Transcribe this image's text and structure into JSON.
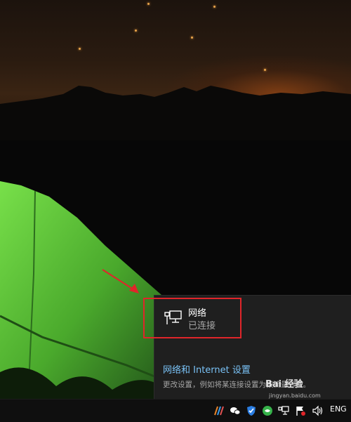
{
  "flyout": {
    "network_name": "网络",
    "network_status": "已连接",
    "settings_link": "网络和 Internet 设置",
    "settings_description": "更改设置，例如将某连接设置为按流量计费。"
  },
  "taskbar": {
    "language": "ENG",
    "tray_icons": [
      "color-app-icon",
      "wechat-icon",
      "shield-icon",
      "green-app-icon",
      "network-icon",
      "flag-icon",
      "volume-icon"
    ]
  },
  "watermark": {
    "logo_text": "Bai 经验",
    "url": "jingyan.baidu.com"
  },
  "colors": {
    "flyout_background": "#1f1f1f",
    "link": "#79c1f5",
    "highlight_box": "#e0252a",
    "annotation_arrow": "#e0252a",
    "tent": "#5ec43c"
  }
}
